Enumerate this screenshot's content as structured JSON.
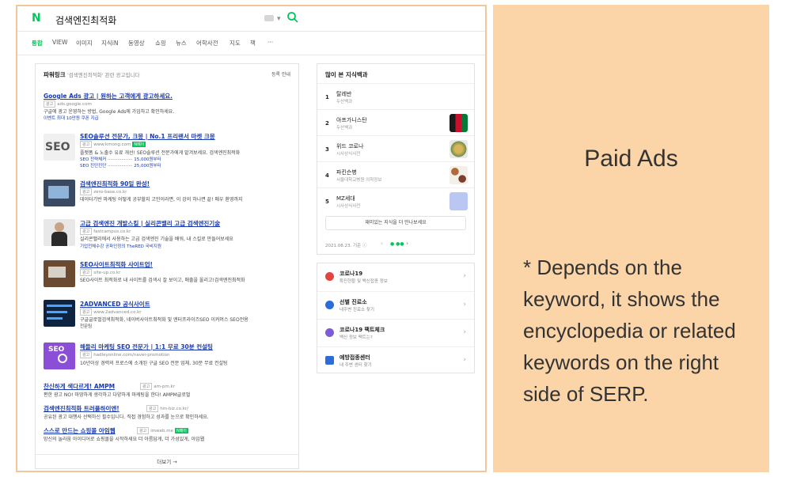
{
  "header": {
    "logo": "N",
    "query": "검색엔진최적화"
  },
  "tabs": [
    "통합",
    "VIEW",
    "이미지",
    "지식iN",
    "동영상",
    "쇼핑",
    "뉴스",
    "어학사전",
    "지도",
    "책",
    "···"
  ],
  "powerlink": {
    "title": "파워링크",
    "subtitle": "'검색엔진최적화' 관련 광고입니다",
    "info": "등록 안내",
    "more": "더보기 →",
    "ads": [
      {
        "title": "Google Ads 광고 | 원하는 고객에게 광고하세요.",
        "url": "ads.google.com",
        "desc": "구글에 광고 운영하는 방법, Google Ads에 가입하고 확인하세요.",
        "sub": "이벤트  최대 10만원 쿠폰 지급"
      },
      {
        "title": "SEO솔루션 전문가, 크몽 | No.1 프리랜서 마켓 크몽",
        "url": "www.kmong.com",
        "badge": "N페이",
        "desc": "플랫폼 & 노출수 유료 개선! SEO솔루션 전문가에게 맡겨보세요. 검색엔진최적화",
        "sub": "SEO 전략체커 ·················· 15,000원부터",
        "sub2": "SEO 진단진단 ·················· 25,000원부터"
      },
      {
        "title": "검색엔진최적화 90일 완성!",
        "url": "zero-base.co.kr",
        "desc": "데이터기반 마케팅 어떻게 공부할지 고민이라면, 이 강의 하나면 끝! 매우 환영까지"
      },
      {
        "title": "고급 검색엔진 개발스킬 | 실리콘밸리 고급 검색엔진기술",
        "url": "fastcampus.co.kr",
        "desc": "실리콘밸리에서 사용하는 고급 검색엔진 기술을 배워, 내 스킬로 만들어보세요",
        "sub": "기업전체수강   공파인정의   TheRED   국비지원"
      },
      {
        "title": "SEO사이트최적화 사이트업!",
        "url": "site-up.co.kr",
        "desc": "SEO사이트 최적화로 내 사이트를 검색시 잘 보이고, 매출을 올리고!검색엔진최적화"
      },
      {
        "title": "2ADVANCED 공식사이트",
        "url": "www.2advanced.co.kr",
        "desc": "구글글로벌검색최적화, 네이버사이트최적화 및 엔터프라이즈SEO 이커머스 SEO전용",
        "sub": "전문팀"
      },
      {
        "title": "해들리 마케팅 SEO 전문가 | 1:1 무료 30분 컨설팅",
        "url": "hadleyonline.com/naver-promotion",
        "desc": "10년이상 경력의 프로스에 소개된 구글 SEO 전문 업체, 30분 무료 컨설팅"
      },
      {
        "title": "찬신하게 색다르게! AMPM",
        "url": "am-pm.kr",
        "desc": "편한 광고 NO! 마땅하게 생각하고 다양하게 마케팅을 한다! AMPM글로벌"
      },
      {
        "title": "검색엔진최적화 트러플하이엔!",
        "url": "hm-biz.co.kr/",
        "desc": "공유된 광고 대행사 선택하신 필수입니다. 직접 경험하고 성과를 눈으로 확인하세요."
      },
      {
        "title": "스스로 만드는 쇼핑몰 아임웹",
        "url": "imweb.me",
        "badge": "N페이",
        "desc": "망신의 놀라움 아이디어로 쇼핑몰을 시작하세요 더 아름답게, 더 가성있게, 아임웹"
      }
    ]
  },
  "knowledge": {
    "title": "많이 본 지식백과",
    "items": [
      {
        "rank": "1",
        "name": "탈레반",
        "cat": "두산백과"
      },
      {
        "rank": "2",
        "name": "아프가니스탄",
        "cat": "두산백과"
      },
      {
        "rank": "3",
        "name": "위드 코로나",
        "cat": "시사상식사전"
      },
      {
        "rank": "4",
        "name": "파킨슨병",
        "cat": "서울대학교병원 의학정보"
      },
      {
        "rank": "5",
        "name": "MZ세대",
        "cat": "시사상식사전"
      }
    ],
    "button": "재미있는 지식을 더 만나보세요",
    "footer": "2021.08.23. 기준 ⓘ"
  },
  "covid": [
    {
      "name": "코로나19",
      "desc": "확진현황 및 백신접종 정보",
      "color": "#e0463f"
    },
    {
      "name": "선별 진료소",
      "desc": "내주변 진료소 찾기",
      "color": "#2d6bd9"
    },
    {
      "name": "코로나19 팩트체크",
      "desc": "백신 정보 팩트는?",
      "color": "#7b5cd6"
    },
    {
      "name": "예방접종센터",
      "desc": "내 주변 센터 찾기",
      "color": "#2d6bd9"
    }
  ],
  "note": {
    "title": "Paid Ads",
    "body": "* Depends on the keyword, it shows the encyclopedia or related keywords on the right side of SERP."
  },
  "colors": {
    "accent": "#03c75a",
    "link": "#1a3bb3",
    "note_bg": "#fbd4a8",
    "frame": "#f2c79b"
  }
}
